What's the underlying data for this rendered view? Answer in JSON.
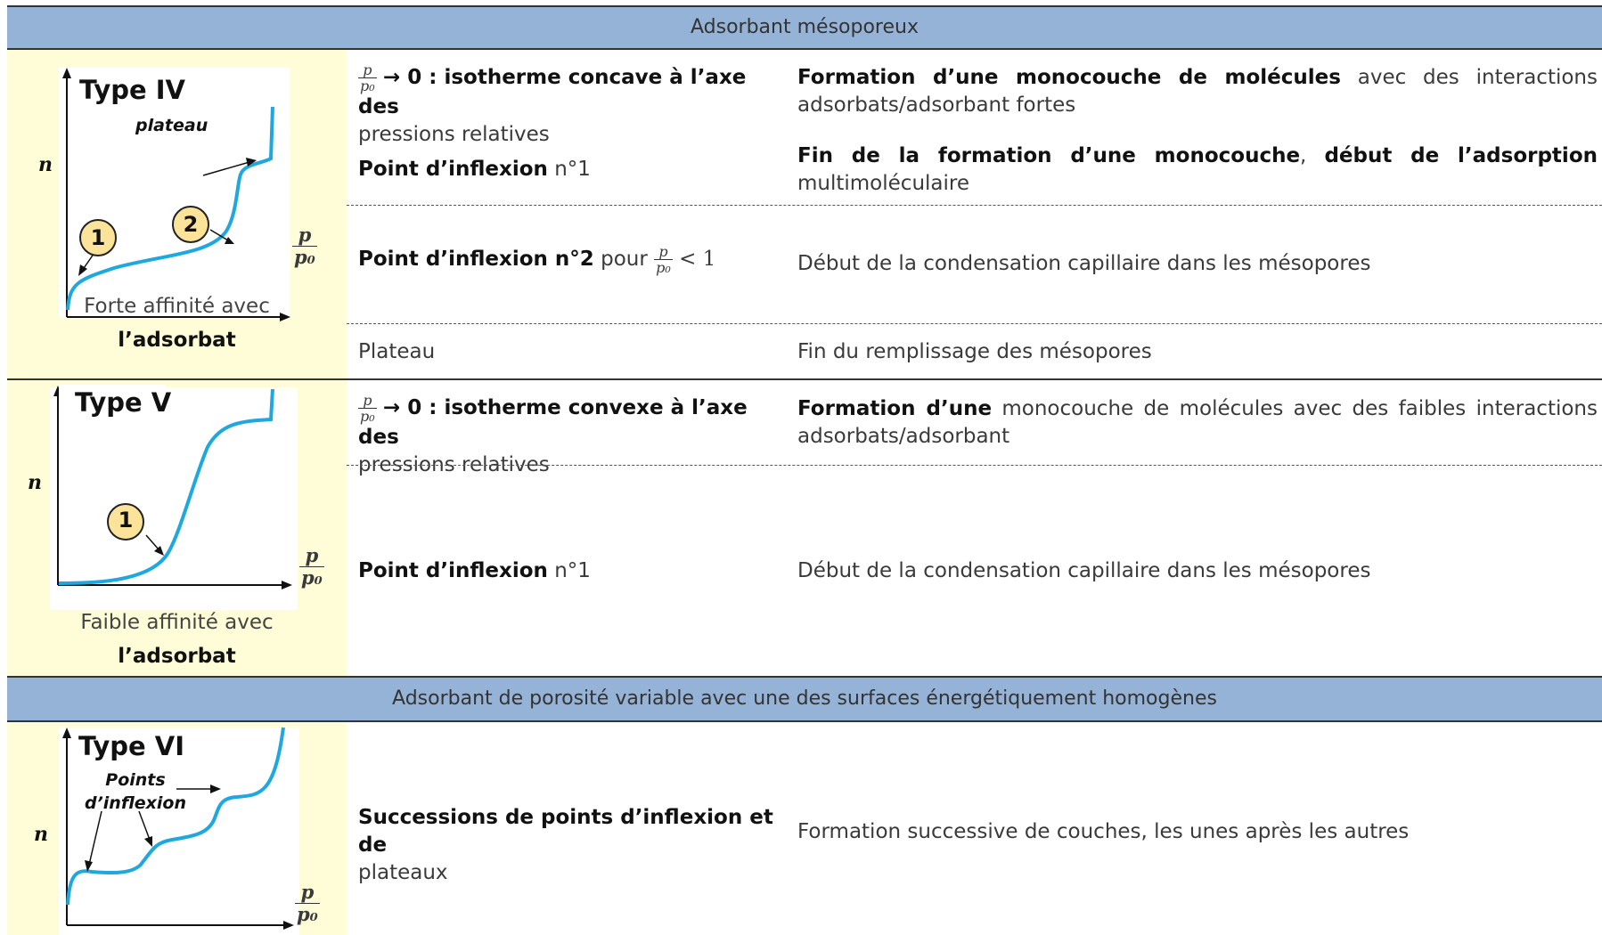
{
  "section1": {
    "header": "Adsorbant mésoporeux"
  },
  "type4": {
    "graph": {
      "title": "Type IV",
      "y_label": "n",
      "x_label_num": "p",
      "x_label_den": "p₀",
      "plateau_label": "plateau",
      "marker1": "1",
      "marker2": "2",
      "curve_color": "#1fa8e0",
      "marker_fill": "#fbe39a"
    },
    "caption_line1": "Forte affinité avec",
    "caption_line2": "l’adsorbat",
    "rows": [
      {
        "frac_num": "p",
        "frac_den": "p₀",
        "left_bold": "→ 0 : isotherme concave à l’axe des",
        "left_rest": "pressions relatives",
        "right_bold": "Formation d’une monocouche de molécules",
        "right_rest": " avec des interactions",
        "right_line2": "adsorbats/adsorbant fortes"
      },
      {
        "left_bold": "Point d’inflexion",
        "left_rest": " n°1",
        "right_bold": "Fin de la formation d’une monocouche",
        "right_mid": ", ",
        "right_bold2": "début de l’adsorption",
        "right_line2": "multimoléculaire"
      },
      {
        "left_bold": "Point d’inflexion n°2",
        "left_rest": " pour ",
        "frac_num": "p",
        "frac_den": "p₀",
        "left_tail": " < 1",
        "right": "Début de la condensation capillaire dans les mésopores"
      },
      {
        "left": "Plateau",
        "right": "Fin du remplissage des mésopores"
      }
    ]
  },
  "type5": {
    "graph": {
      "title": "Type V",
      "y_label": "n",
      "x_label_num": "p",
      "x_label_den": "p₀",
      "marker1": "1"
    },
    "caption_line1": "Faible affinité avec",
    "caption_line2": "l’adsorbat",
    "rows": [
      {
        "frac_num": "p",
        "frac_den": "p₀",
        "left_bold": "→ 0 : isotherme convexe à l’axe des",
        "left_rest": "pressions relatives",
        "right_bold": "Formation d’une",
        "right_rest": " monocouche de molécules avec des faibles interactions",
        "right_line2": "adsorbats/adsorbant"
      },
      {
        "left_bold": "Point d’inflexion",
        "left_rest": " n°1",
        "right": "Début de la condensation capillaire dans les mésopores"
      }
    ]
  },
  "section2": {
    "header": "Adsorbant de porosité variable avec une des surfaces énergétiquement homogènes"
  },
  "type6": {
    "graph": {
      "title": "Type VI",
      "y_label": "n",
      "x_label_num": "p",
      "x_label_den": "p₀",
      "inflexion_label_line1": "Points",
      "inflexion_label_line2": "d’inflexion"
    },
    "row": {
      "left_bold": "Successions de points d’inflexion et de",
      "left_rest": "plateaux",
      "right": "Formation successive de couches, les unes après les autres"
    }
  }
}
